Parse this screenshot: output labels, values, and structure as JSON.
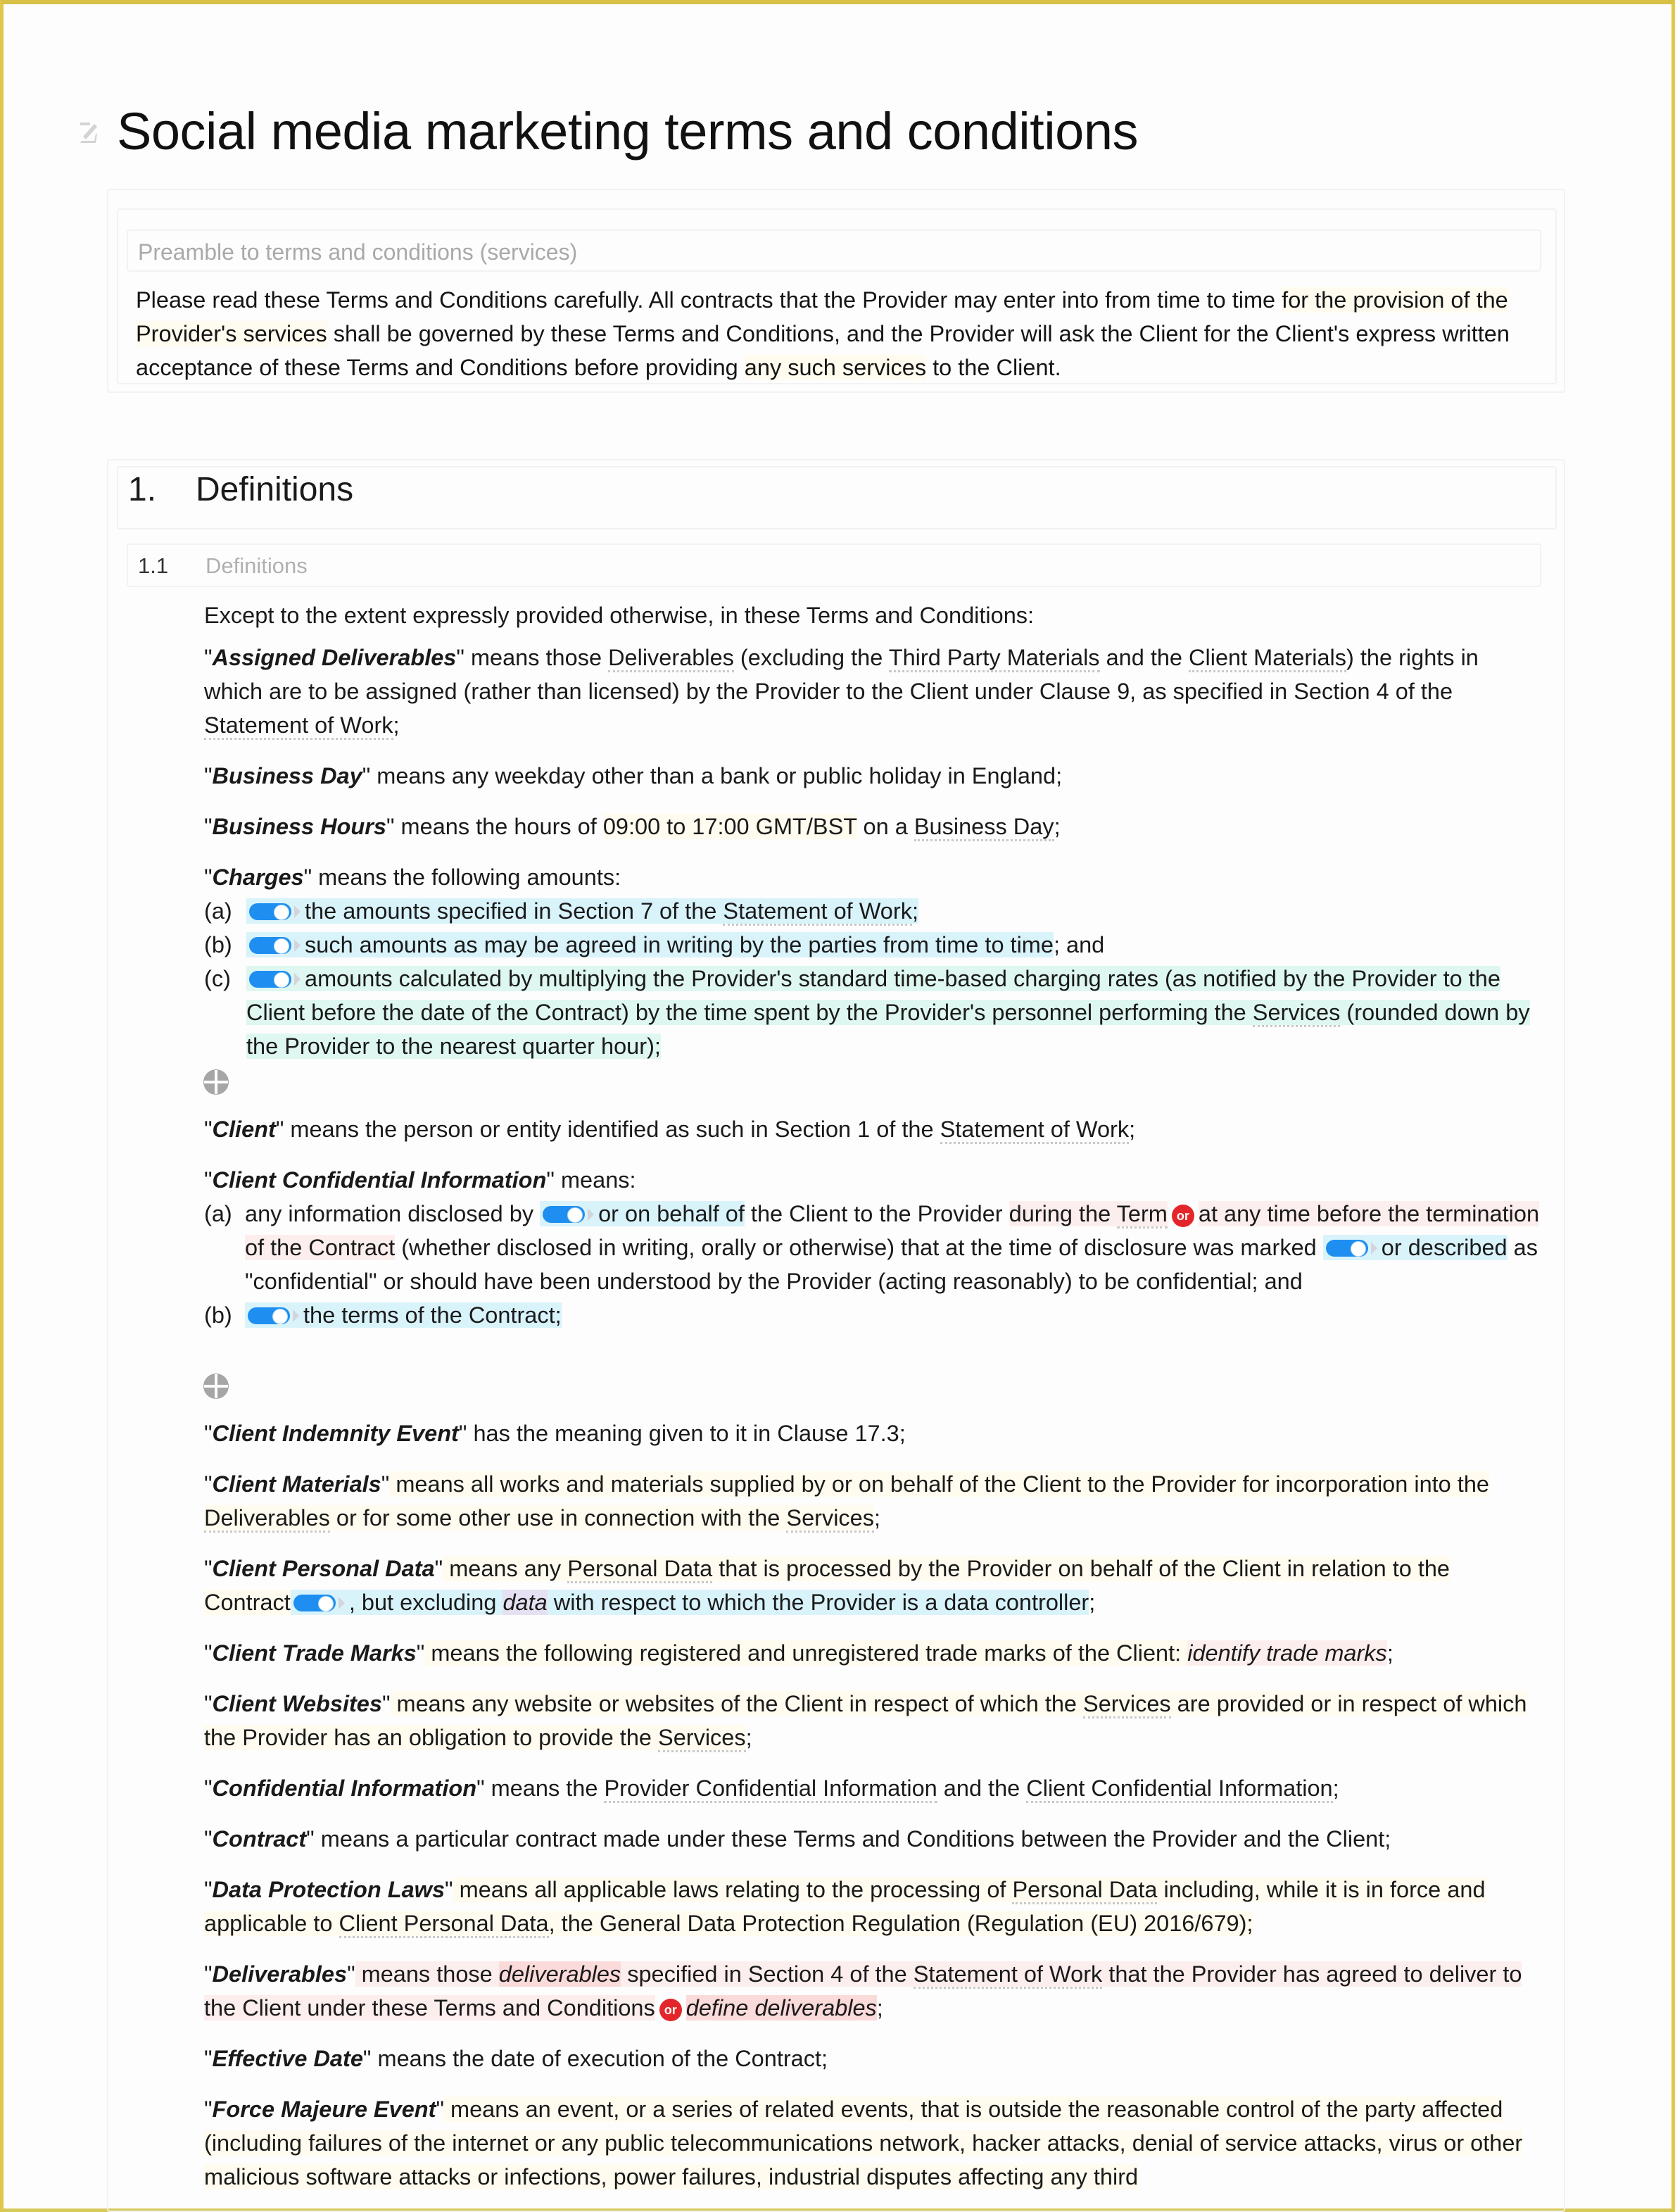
{
  "document": {
    "title": "Social media marketing terms and conditions",
    "preamble": {
      "heading": "Preamble to terms and conditions (services)",
      "text_parts": [
        "Please read these Terms and Conditions carefully. All contracts that the Provider may enter into from time to time ",
        "for the provision of the Provider's services",
        " shall be governed by these Terms and Conditions, and the Provider will ask the Client for the Client's express written acceptance of these Terms and Conditions before providing ",
        "any such services",
        " to the Client."
      ]
    },
    "section": {
      "number": "1.",
      "title": "Definitions",
      "subsection_number": "1.1",
      "subsection_title": "Definitions",
      "intro": "Except to the extent expressly provided otherwise, in these Terms and Conditions:"
    },
    "definitions": {
      "assigned_deliverables": {
        "term": "Assigned Deliverables",
        "t1": " means those ",
        "l1": "Deliverables",
        "t2": " (excluding the ",
        "l2": "Third Party Materials",
        "t3": " and the ",
        "l3": "Client Materials",
        "t4": ") the rights in which are to be assigned (rather than licensed) by the Provider to the Client under Clause 9, as specified in Section 4 of the ",
        "l4": "Statement of Work",
        "t5": ";"
      },
      "business_day": {
        "term": "Business Day",
        "text": " means any weekday other than a bank or public holiday in England;"
      },
      "business_hours": {
        "term": "Business Hours",
        "t1": " means the hours of ",
        "hl": "09:00 to 17:00 GMT/BST",
        "t2": " on a ",
        "l1": "Business Day",
        "t3": ";"
      },
      "charges": {
        "term": "Charges",
        "text": " means the following amounts:",
        "items": [
          {
            "label": "(a)",
            "text": "the amounts specified in Section 7 of the ",
            "link": "Statement of Work",
            "tail": ";",
            "toggle_on": true
          },
          {
            "label": "(b)",
            "text": "such amounts as may be agreed in writing by the parties from time to time",
            "link": "",
            "tail": "; and",
            "toggle_on": true
          },
          {
            "label": "(c)",
            "text": "amounts calculated by multiplying the Provider's standard time-based charging rates (as notified by the Provider to the Client before the date of the Contract) by the time spent by the Provider's personnel performing the ",
            "link": "Services",
            "tail": " (rounded down by the Provider to the nearest quarter hour);",
            "toggle_on": true
          }
        ]
      },
      "client": {
        "term": "Client",
        "t1": " means the person or entity identified as such in Section 1 of the ",
        "l1": "Statement of Work",
        "t2": ";"
      },
      "client_confidential_information": {
        "term": "Client Confidential Information",
        "text": " means:",
        "item_a": {
          "label": "(a)",
          "t1": "any information disclosed by ",
          "opt1": "or on behalf of",
          "t2": " the Client to the Provider ",
          "opt2": "during the ",
          "l1": "Term",
          "or_label": "or",
          "opt3": "at any time before the termination of the Contract",
          "t3": " (whether disclosed in writing, orally or otherwise) that at the time of disclosure was marked ",
          "opt4": "or described",
          "t4": " as \"confidential\" or should have been understood by the Provider (acting reasonably) to be confidential; and"
        },
        "item_b": {
          "label": "(b)",
          "text": "the terms of the Contract",
          "tail": ";"
        }
      },
      "client_indemnity_event": {
        "term": "Client Indemnity Event",
        "text": " has the meaning given to it in Clause 17.3;"
      },
      "client_materials": {
        "term": "Client Materials",
        "t1": " means all works and materials supplied by or on behalf of the Client to the Provider for incorporation into the ",
        "l1": "Deliverables",
        "t2": " or for some other use in connection with the ",
        "l2": "Services",
        "t3": ";"
      },
      "client_personal_data": {
        "term": "Client Personal Data",
        "t1": " means any ",
        "l1": "Personal Data",
        "t2": " that is processed by the Provider on behalf of the Client in relation to the Contract",
        "t3": ", but excluding ",
        "var": "data",
        "t4": " with respect to which the Provider is a data controller",
        "t5": ";"
      },
      "client_trade_marks": {
        "term": "Client Trade Marks",
        "t1": " means the following registered and unregistered trade marks of the Client: ",
        "var": "identify trade marks",
        "t2": ";"
      },
      "client_websites": {
        "term": "Client Websites",
        "t1": " means any website or websites of the Client in respect of which the ",
        "l1": "Services",
        "t2": " are provided or in respect of which the Provider has an obligation to provide the ",
        "l2": "Services",
        "t3": ";"
      },
      "confidential_information": {
        "term": "Confidential Information",
        "t1": " means the ",
        "l1": "Provider Confidential Information",
        "t2": " and the ",
        "l2": "Client Confidential Information",
        "t3": ";"
      },
      "contract": {
        "term": "Contract",
        "text": " means a particular contract made under these Terms and Conditions between the Provider and the Client;"
      },
      "data_protection_laws": {
        "term": "Data Protection Laws",
        "t1": " means all applicable laws relating to the processing of ",
        "l1": "Personal Data",
        "t2": " including, while it is in force and applicable to ",
        "l2": "Client Personal Data",
        "t3": ", the General Data Protection Regulation (Regulation (EU) 2016/679);"
      },
      "deliverables": {
        "term": "Deliverables",
        "t1": " means those ",
        "var1": "deliverables",
        "t2": " specified in Section 4 of the ",
        "l1": "Statement of Work",
        "t3": " that the Provider has agreed to deliver to the Client under these Terms and Conditions",
        "or_label": "or",
        "var2": "define deliverables",
        "t4": ";"
      },
      "effective_date": {
        "term": "Effective Date",
        "text": " means the date of execution of the Contract;"
      },
      "force_majeure_event": {
        "term": "Force Majeure Event",
        "text": " means an event, or a series of related events, that is outside the reasonable control of the party affected (including failures of the internet or any public telecommunications network, hacker attacks, denial of service attacks, virus or other malicious software attacks or infections, power failures, industrial disputes affecting any third"
      }
    },
    "colors": {
      "frame_border": "#e0c64a",
      "toggle_on": "#1e8ff0",
      "or_badge": "#e3262b",
      "optional_highlight": "#d9f3fb",
      "alternative_highlight": "#fdeeee"
    }
  }
}
